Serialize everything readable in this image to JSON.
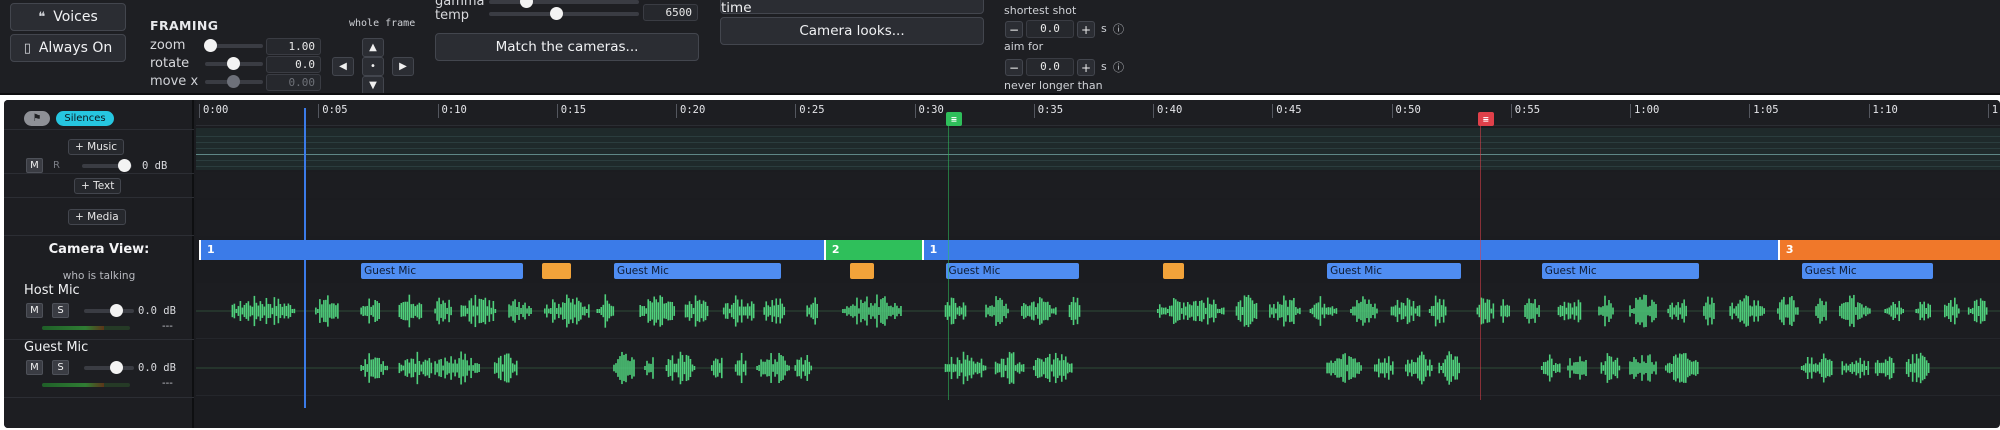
{
  "left_buttons": {
    "voices": "Voices",
    "always_on": "Always On"
  },
  "framing": {
    "title": "FRAMING",
    "whole_frame": "whole frame",
    "zoom_label": "zoom",
    "zoom_value": "1.00",
    "rotate_label": "rotate",
    "rotate_value": "0.0",
    "movex_label": "move x",
    "movex_value": "0.00"
  },
  "color": {
    "gamma_label": "gamma",
    "temp_label": "temp",
    "temp_value": "6500",
    "match_button": "Match the cameras..."
  },
  "camera": {
    "remember_button": "Remember these cameras for next time",
    "looks_button": "Camera looks..."
  },
  "shot_length": {
    "shortest_label": "shortest shot",
    "shortest_value": "0.0",
    "aim_label": "aim for",
    "aim_value": "0.0",
    "longest_label": "never longer than",
    "unit": "s"
  },
  "tracks": {
    "silences_pill": "Silences",
    "music_button": "+ Music",
    "music_db": "0 dB",
    "text_button": "+ Text",
    "media_button": "+ Media",
    "camera_view_label": "Camera View:",
    "who_is_talking": "who is talking",
    "host_name": "Host Mic",
    "host_db": "0.0 dB",
    "guest_name": "Guest Mic",
    "guest_db": "0.0 dB",
    "mute_label": "M",
    "solo_label": "S",
    "record_label": "R",
    "meter_dash": "---"
  },
  "ruler_ticks": [
    "0:00",
    "0:05",
    "0:10",
    "0:15",
    "0:20",
    "0:25",
    "0:30",
    "0:35",
    "0:40",
    "0:45",
    "0:50",
    "0:55",
    "1:00",
    "1:05",
    "1:10",
    "1:"
  ],
  "camera_segments": [
    {
      "label": "1",
      "start": 0.0,
      "end": 26.2,
      "color": "#3b7be8"
    },
    {
      "label": "2",
      "start": 26.2,
      "end": 30.3,
      "color": "#2fbf5b"
    },
    {
      "label": "1",
      "start": 30.3,
      "end": 66.2,
      "color": "#3b7be8"
    },
    {
      "label": "3",
      "start": 66.2,
      "end": 75.8,
      "color": "#f0782a"
    }
  ],
  "caption_blocks": [
    {
      "label": "Guest Mic",
      "start": 6.8,
      "end": 13.6
    },
    {
      "label": "Guest Mic",
      "start": 17.4,
      "end": 24.4
    },
    {
      "label": "Guest Mic",
      "start": 31.3,
      "end": 36.9
    },
    {
      "label": "Guest Mic",
      "start": 47.3,
      "end": 52.9
    },
    {
      "label": "Guest Mic",
      "start": 56.3,
      "end": 62.9
    },
    {
      "label": "Guest Mic",
      "start": 67.2,
      "end": 72.7
    }
  ],
  "orange_blocks": [
    {
      "start": 14.4,
      "end": 15.6
    },
    {
      "start": 27.3,
      "end": 28.3
    },
    {
      "start": 40.4,
      "end": 41.3
    }
  ],
  "playhead_time": 4.4,
  "markers": [
    {
      "time": 31.4,
      "color": "#2fbf5b"
    },
    {
      "time": 53.7,
      "color": "#e0404a"
    }
  ],
  "host_wave_segments": [
    [
      1.4,
      4.0
    ],
    [
      4.9,
      5.9
    ],
    [
      6.8,
      7.6
    ],
    [
      8.4,
      9.4
    ],
    [
      9.9,
      10.6
    ],
    [
      11.0,
      12.5
    ],
    [
      13.0,
      14.0
    ],
    [
      14.5,
      16.4
    ],
    [
      16.7,
      17.4
    ],
    [
      18.5,
      20.0
    ],
    [
      20.4,
      21.4
    ],
    [
      22.0,
      23.3
    ],
    [
      23.7,
      24.6
    ],
    [
      25.5,
      26.0
    ],
    [
      27.0,
      29.5
    ],
    [
      31.3,
      32.2
    ],
    [
      33.0,
      34.0
    ],
    [
      34.5,
      36.0
    ],
    [
      36.5,
      37.0
    ],
    [
      40.2,
      43.0
    ],
    [
      43.5,
      44.4
    ],
    [
      44.9,
      46.2
    ],
    [
      46.6,
      47.7
    ],
    [
      48.3,
      49.4
    ],
    [
      50.0,
      51.2
    ],
    [
      51.6,
      52.3
    ],
    [
      53.6,
      54.3
    ],
    [
      54.6,
      55.0
    ],
    [
      55.6,
      56.2
    ],
    [
      57.0,
      58.0
    ],
    [
      58.7,
      59.3
    ],
    [
      60.0,
      61.1
    ],
    [
      61.6,
      62.4
    ],
    [
      63.1,
      63.6
    ],
    [
      64.2,
      65.7
    ],
    [
      66.2,
      67.1
    ],
    [
      67.8,
      68.3
    ],
    [
      68.8,
      70.1
    ],
    [
      70.7,
      71.5
    ],
    [
      72.0,
      72.6
    ],
    [
      73.2,
      73.8
    ],
    [
      74.2,
      75.0
    ]
  ],
  "guest_wave_segments": [
    [
      6.8,
      7.9
    ],
    [
      8.4,
      9.8
    ],
    [
      9.9,
      11.8
    ],
    [
      12.4,
      13.4
    ],
    [
      17.4,
      18.3
    ],
    [
      18.7,
      19.1
    ],
    [
      19.6,
      20.8
    ],
    [
      21.5,
      22.0
    ],
    [
      22.5,
      23.0
    ],
    [
      23.4,
      24.8
    ],
    [
      25.0,
      25.7
    ],
    [
      31.3,
      33.0
    ],
    [
      33.4,
      34.6
    ],
    [
      35.0,
      36.6
    ],
    [
      47.3,
      48.8
    ],
    [
      49.3,
      50.1
    ],
    [
      50.6,
      51.7
    ],
    [
      52.0,
      52.9
    ],
    [
      56.3,
      57.1
    ],
    [
      57.4,
      58.2
    ],
    [
      58.8,
      59.6
    ],
    [
      60.0,
      61.1
    ],
    [
      61.5,
      62.9
    ],
    [
      67.2,
      68.5
    ],
    [
      68.9,
      70.0
    ],
    [
      70.3,
      71.1
    ],
    [
      71.6,
      72.6
    ]
  ]
}
